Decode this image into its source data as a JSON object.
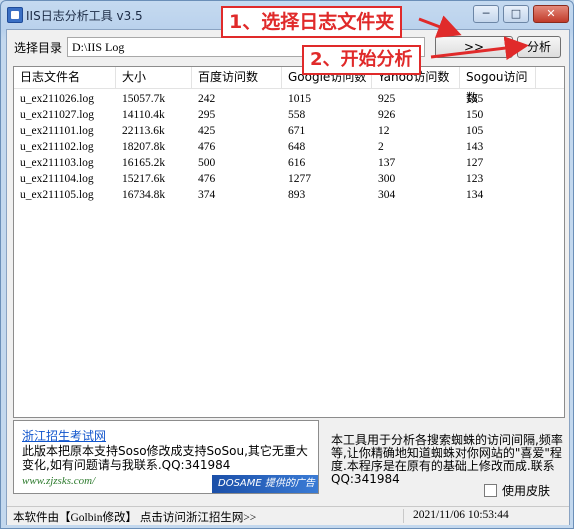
{
  "window": {
    "title": "IIS日志分析工具 v3.5",
    "controls": {
      "minimize": "─",
      "maximize": "□",
      "close": "✕"
    }
  },
  "toolbar": {
    "dir_label": "选择目录",
    "dir_value": "D:\\IIS Log",
    "browse_label": ">>",
    "analyze_label": "分析"
  },
  "annotations": {
    "step1": "1、选择日志文件夹",
    "step2": "2、开始分析"
  },
  "table": {
    "columns": [
      "日志文件名",
      "大小",
      "百度访问数",
      "Google访问数",
      "Yahoo访问数",
      "Sogou访问数"
    ],
    "rows": [
      [
        "u_ex211026.log",
        "15057.7k",
        "242",
        "1015",
        "925",
        "185"
      ],
      [
        "u_ex211027.log",
        "14110.4k",
        "295",
        "558",
        "926",
        "150"
      ],
      [
        "u_ex211101.log",
        "22113.6k",
        "425",
        "671",
        "12",
        "105"
      ],
      [
        "u_ex211102.log",
        "18207.8k",
        "476",
        "648",
        "2",
        "143"
      ],
      [
        "u_ex211103.log",
        "16165.2k",
        "500",
        "616",
        "137",
        "127"
      ],
      [
        "u_ex211104.log",
        "15217.6k",
        "476",
        "1277",
        "300",
        "123"
      ],
      [
        "u_ex211105.log",
        "16734.8k",
        "374",
        "893",
        "304",
        "134"
      ]
    ]
  },
  "ad": {
    "title": "浙江招生考试网",
    "text": "此版本把原本支持Soso修改成支持SoSou,其它无重大变化,如有问题请与我联系.QQ:341984",
    "url": "www.zjzsks.com/",
    "logo": "DOSAME 提供的广告"
  },
  "description": "本工具用于分析各搜索蜘蛛的访问间隔,频率等,让你精确地知道蜘蛛对你网站的\"喜爱\"程度.本程序是在原有的基础上修改而成.联系QQ:341984",
  "skin_checkbox_label": "使用皮肤",
  "status": {
    "left": "本软件由【Golbin修改】 点击访问浙江招生网>>",
    "right": "2021/11/06 10:53:44"
  },
  "colors": {
    "annotation": "#e02a2a",
    "link": "#1155cc"
  }
}
